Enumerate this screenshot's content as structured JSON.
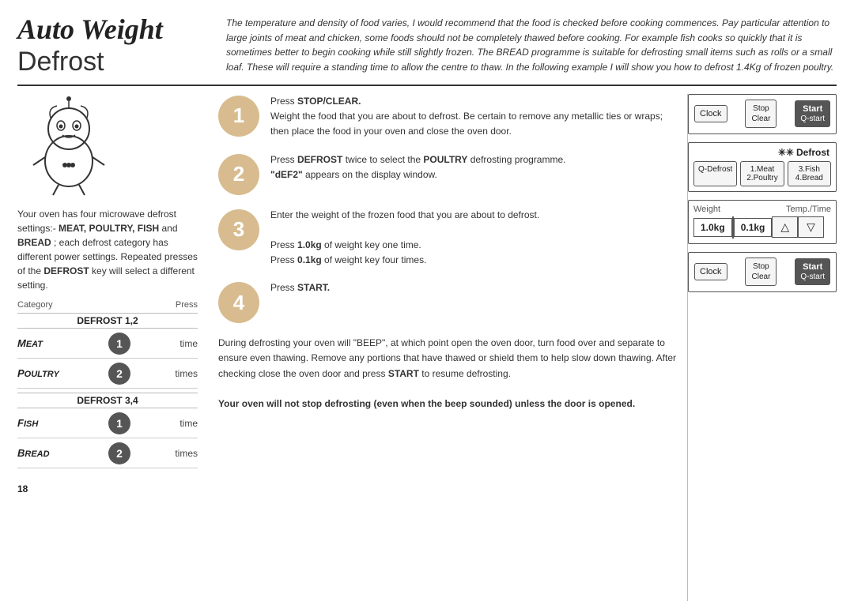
{
  "page": {
    "number": "18",
    "title_italic": "Auto Weight",
    "title_normal": "Defrost"
  },
  "header": {
    "description": "The temperature and density of food varies, I would recommend that the food is checked before cooking commences. Pay particular attention to large joints of meat and chicken, some foods should not be completely thawed before cooking. For example fish cooks so quickly that it is sometimes better to begin cooking while still slightly frozen. The BREAD programme is suitable for defrosting small items such as rolls or a small loaf. These will require a standing time to allow the centre to thaw. In the following example I will show you how to defrost 1.4Kg of frozen poultry."
  },
  "left": {
    "desc1": "Your oven has four microwave defrost settings:-",
    "desc_bold": "MEAT, POULTRY, FISH",
    "desc2": " and ",
    "desc_bold2": "BREAD",
    "desc3": "; each defrost category has different power settings. Repeated presses of the ",
    "desc_bold3": "DEFROST",
    "desc4": " key will select a different setting.",
    "category_label": "Category",
    "press_label": "Press",
    "defrost12": "DEFROST 1,2",
    "defrost34": "DEFROST 3,4",
    "rows": [
      {
        "label": "Meat",
        "num": "1",
        "times": "time"
      },
      {
        "label": "Poultry",
        "num": "2",
        "times": "times"
      },
      {
        "label": "Fish",
        "num": "1",
        "times": "time"
      },
      {
        "label": "Bread",
        "num": "2",
        "times": "times"
      }
    ]
  },
  "steps": [
    {
      "num": "1",
      "instruction_prefix": "Press ",
      "instruction_bold": "STOP/CLEAR.",
      "instruction_rest": "\nWeight the food that you are about to defrost. Be certain to remove any metallic ties or wraps; then place the food in your oven and close the oven door."
    },
    {
      "num": "2",
      "instruction_prefix": "Press ",
      "instruction_bold": "DEFROST",
      "instruction_mid": " twice to select the ",
      "instruction_bold2": "POULTRY",
      "instruction_mid2": " defrosting programme.\n",
      "instruction_quote": "“dEF2”",
      "instruction_rest2": " appears on the display window."
    },
    {
      "num": "3",
      "line1": "Enter the weight of the frozen food that you are about to defrost.",
      "line2": "Press ",
      "line2_bold": "1.0kg",
      "line2_rest": " of weight key one time.",
      "line3": "Press ",
      "line3_bold": "0.1kg",
      "line3_rest": " of weight key four times."
    },
    {
      "num": "4",
      "instruction_prefix": "Press ",
      "instruction_bold": "START."
    }
  ],
  "bottom": {
    "para1": "During defrosting your oven will \"BEEP\", at which point open the oven door, turn food over and separate to ensure even thawing. Remove any portions that have thawed or shield them to help slow down thawing. After checking close the oven door and press ",
    "para1_bold": "START",
    "para1_end": " to resume defrosting.",
    "para2": "Your oven will not stop defrosting (even when the beep sounded) unless the door is opened."
  },
  "panels": {
    "panel1": {
      "clock_label": "Clock",
      "stop_label": "Stop",
      "clear_label": "Clear",
      "start_label": "Start",
      "qstart_label": "Q-start"
    },
    "defrost_panel": {
      "title": "Defrost",
      "qdefrost": "Q-Defrost",
      "meat": "1.Meat\n2.Poultry",
      "fish": "3.Fish\n4.Bread"
    },
    "weight_panel": {
      "weight_label": "Weight",
      "temp_label": "Temp./Time",
      "val1": "1.0kg",
      "val2": "0.1kg",
      "arrow_up": "△",
      "arrow_down": "▽"
    },
    "panel4": {
      "clock_label": "Clock",
      "stop_label": "Stop",
      "clear_label": "Clear",
      "start_label": "Start",
      "qstart_label": "Q-start"
    }
  }
}
